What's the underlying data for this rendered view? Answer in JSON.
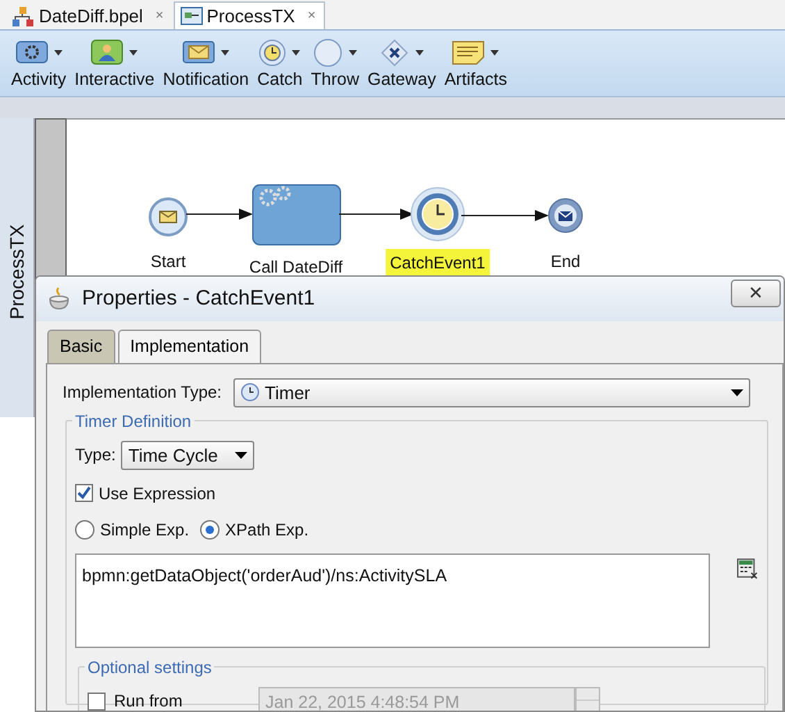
{
  "editor_tabs": [
    {
      "label": "DateDiff.bpel",
      "kind": "bpel",
      "close": "×",
      "selected": false
    },
    {
      "label": "ProcessTX",
      "kind": "process",
      "close": "×",
      "selected": true
    }
  ],
  "toolbar": [
    {
      "label": "Activity",
      "kind": "activity"
    },
    {
      "label": "Interactive",
      "kind": "interactive"
    },
    {
      "label": "Notification",
      "kind": "notification"
    },
    {
      "label": "Catch",
      "kind": "catch"
    },
    {
      "label": "Throw",
      "kind": "throw"
    },
    {
      "label": "Gateway",
      "kind": "gateway"
    },
    {
      "label": "Artifacts",
      "kind": "artifacts"
    }
  ],
  "process": {
    "lane_label": "ProcessTX",
    "nodes": [
      {
        "label": "Start",
        "kind": "start",
        "selected": false
      },
      {
        "label": "Call DateDiff",
        "kind": "task",
        "selected": false
      },
      {
        "label": "CatchEvent1",
        "kind": "timer",
        "selected": true
      },
      {
        "label": "End",
        "kind": "end",
        "selected": false
      }
    ]
  },
  "dialog": {
    "title": "Properties - CatchEvent1",
    "close": "✕",
    "tabs": [
      {
        "label": "Basic",
        "selected": false
      },
      {
        "label": "Implementation",
        "selected": true
      }
    ],
    "implementation_type": {
      "label": "Implementation Type:",
      "value": "Timer"
    },
    "timer_definition": {
      "legend": "Timer Definition",
      "type_label": "Type:",
      "type_value": "Time Cycle",
      "use_expression": {
        "label": "Use Expression",
        "checked": true
      },
      "expression_kinds": [
        {
          "label": "Simple Exp.",
          "selected": false
        },
        {
          "label": "XPath Exp.",
          "selected": true
        }
      ],
      "expression": "bpmn:getDataObject('orderAud')/ns:ActivitySLA"
    },
    "optional_settings": {
      "legend": "Optional settings",
      "run_from": {
        "label": "Run from",
        "checked": false,
        "value": "Jan 22, 2015 4:48:54 PM",
        "disabled": true
      }
    }
  }
}
